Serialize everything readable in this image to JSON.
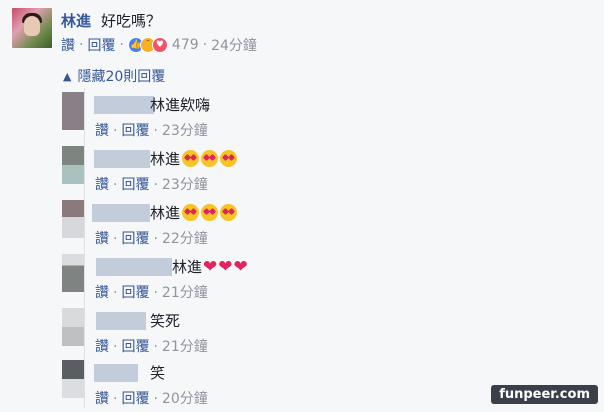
{
  "post_comment": {
    "author": "林進",
    "text": "好吃嗎？",
    "like_label": "讚",
    "reply_label": "回覆",
    "reactions_count": "479",
    "time": "24分鐘"
  },
  "toggle": {
    "label": "隱藏20則回覆"
  },
  "replies": [
    {
      "mention": "林進",
      "text": "欸嗨",
      "emoji": "",
      "like_label": "讚",
      "reply_label": "回覆",
      "time": "23分鐘"
    },
    {
      "mention": "林進",
      "text": "",
      "emoji": "heart-eyes x3",
      "like_label": "讚",
      "reply_label": "回覆",
      "time": "23分鐘"
    },
    {
      "mention": "林進",
      "text": "",
      "emoji": "heart-eyes x3",
      "like_label": "讚",
      "reply_label": "回覆",
      "time": "22分鐘"
    },
    {
      "mention": "林進",
      "text": "",
      "emoji": "hearts x3",
      "like_label": "讚",
      "reply_label": "回覆",
      "time": "21分鐘"
    },
    {
      "mention": "",
      "text": "笑死",
      "emoji": "",
      "like_label": "讚",
      "reply_label": "回覆",
      "time": "21分鐘"
    },
    {
      "mention": "",
      "text": "笑",
      "emoji": "",
      "like_label": "讚",
      "reply_label": "回覆",
      "time": "20分鐘"
    }
  ],
  "watermark": "funpeer.com",
  "colors": {
    "link": "#365899",
    "meta": "#90949c",
    "background": "#f6f7f9"
  }
}
